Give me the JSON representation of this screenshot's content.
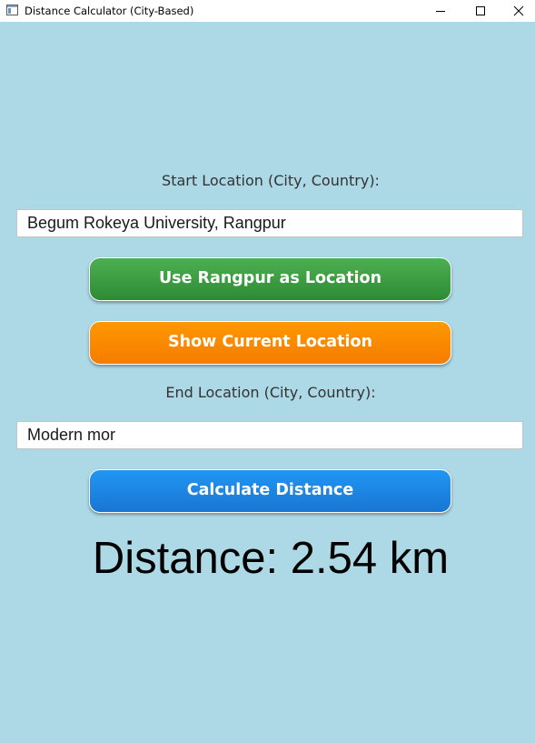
{
  "window": {
    "title": "Distance Calculator (City-Based)",
    "icon": "app-window-icon",
    "controls": [
      "minimize-icon",
      "maximize-icon",
      "close-icon"
    ]
  },
  "form": {
    "start_label": "Start Location (City, Country):",
    "start_value": "Begum Rokeya University, Rangpur",
    "use_rangpur_button": "Use Rangpur as Location",
    "show_current_button": "Show Current Location",
    "end_label": "End Location (City, Country):",
    "end_value": "Modern mor",
    "calculate_button": "Calculate Distance"
  },
  "result": {
    "text": "Distance: 2.54 km"
  },
  "colors": {
    "background": "#add8e6",
    "green_button": "#3f9f45",
    "orange_button": "#fb8c00",
    "blue_button": "#1e88e5"
  }
}
